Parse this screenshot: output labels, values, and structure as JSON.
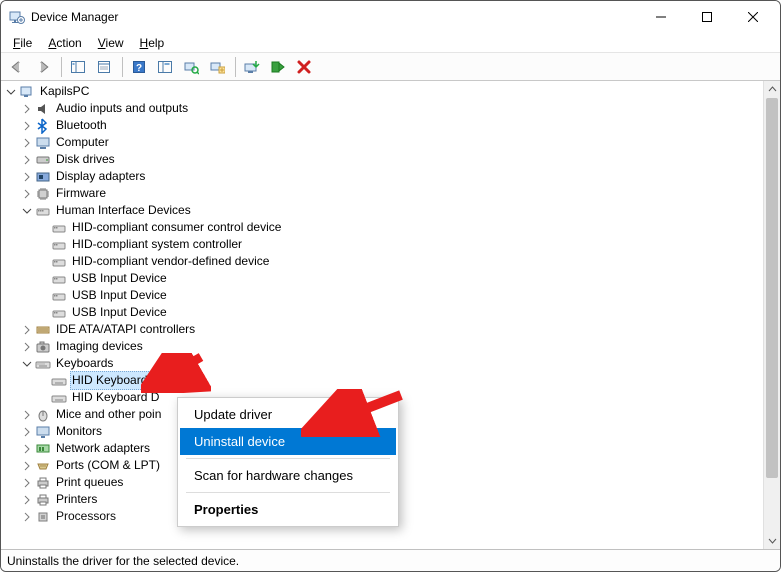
{
  "window": {
    "title": "Device Manager"
  },
  "menu": {
    "file": "File",
    "action": "Action",
    "view": "View",
    "help": "Help"
  },
  "tree": {
    "root": "KapilsPC",
    "audio": "Audio inputs and outputs",
    "bluetooth": "Bluetooth",
    "computer": "Computer",
    "diskdrives": "Disk drives",
    "display": "Display adapters",
    "firmware": "Firmware",
    "hid": "Human Interface Devices",
    "hid_children": {
      "c0": "HID-compliant consumer control device",
      "c1": "HID-compliant system controller",
      "c2": "HID-compliant vendor-defined device",
      "c3": "USB Input Device",
      "c4": "USB Input Device",
      "c5": "USB Input Device"
    },
    "ide": "IDE ATA/ATAPI controllers",
    "imaging": "Imaging devices",
    "keyboards": "Keyboards",
    "kb_children": {
      "k0": "HID Keyboard Device",
      "k1": "HID Keyboard Device"
    },
    "mice": "Mice and other pointing devices",
    "monitors": "Monitors",
    "network": "Network adapters",
    "ports": "Ports (COM & LPT)",
    "printqueues": "Print queues",
    "printers": "Printers",
    "processors": "Processors"
  },
  "context": {
    "update": "Update driver",
    "uninstall": "Uninstall device",
    "scan": "Scan for hardware changes",
    "properties": "Properties"
  },
  "status": "Uninstalls the driver for the selected device."
}
